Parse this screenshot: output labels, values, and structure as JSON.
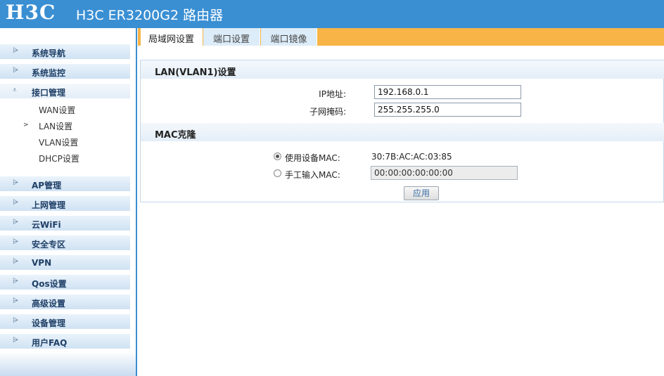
{
  "header": {
    "logo": "H3C",
    "title": "H3C ER3200G2 路由器"
  },
  "sidebar": {
    "items": [
      {
        "label": "系统导航"
      },
      {
        "label": "系统监控"
      },
      {
        "label": "接口管理",
        "sub": [
          "WAN设置",
          "LAN设置",
          "VLAN设置",
          "DHCP设置"
        ],
        "selected_sub": "LAN设置"
      },
      {
        "label": "AP管理"
      },
      {
        "label": "上网管理"
      },
      {
        "label": "云WiFi"
      },
      {
        "label": "安全专区"
      },
      {
        "label": "VPN"
      },
      {
        "label": "Qos设置"
      },
      {
        "label": "高级设置"
      },
      {
        "label": "设备管理"
      },
      {
        "label": "用户FAQ"
      }
    ]
  },
  "tabs": [
    {
      "label": "局域网设置",
      "active": true
    },
    {
      "label": "端口设置",
      "active": false
    },
    {
      "label": "端口镜像",
      "active": false
    }
  ],
  "lan": {
    "heading": "LAN(VLAN1)设置",
    "ip_label": "IP地址:",
    "ip_value": "192.168.0.1",
    "mask_label": "子网掩码:",
    "mask_value": "255.255.255.0"
  },
  "mac": {
    "heading": "MAC克隆",
    "device_label": "使用设备MAC:",
    "device_value": "30:7B:AC:AC:03:85",
    "manual_label": "手工输入MAC:",
    "manual_value": "00:00:00:00:00:00",
    "selected": "device"
  },
  "apply_label": "应用",
  "colors": {
    "header": "#3a8fd3",
    "tabbar": "#f8b447",
    "menu": "#cfe2f3"
  }
}
